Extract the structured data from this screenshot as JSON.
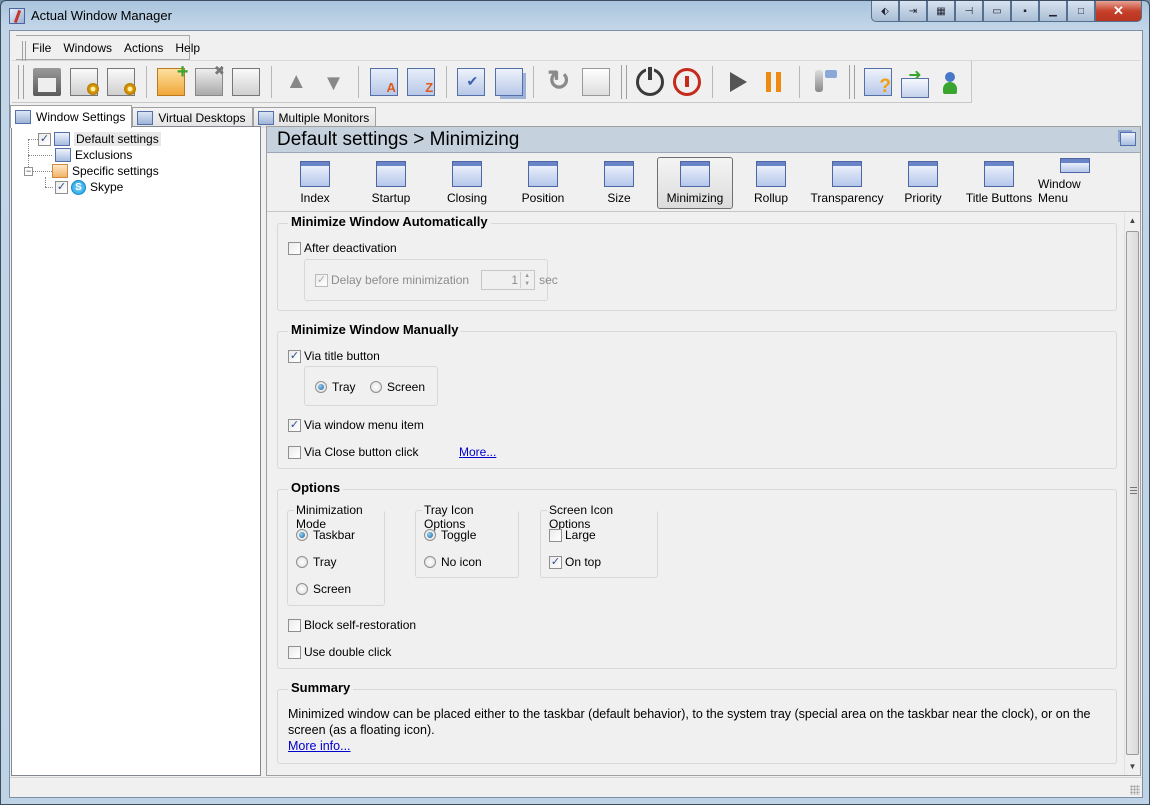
{
  "window": {
    "title": "Actual Window Manager"
  },
  "title_buttons": [
    "move-icon",
    "minimize-to-tray-icon",
    "transparency-icon",
    "stay-on-top-icon",
    "rollup-icon",
    "minimize-alt-icon",
    "minimize-icon",
    "maximize-icon",
    "close-icon"
  ],
  "menu": [
    "File",
    "Windows",
    "Actions",
    "Help"
  ],
  "toolbar": [
    {
      "name": "save",
      "icon": "floppy-icon",
      "cls": "i-floppy"
    },
    {
      "name": "settings-user",
      "icon": "settings-user-icon",
      "cls": "i-doc i-gear"
    },
    {
      "name": "settings-user-2",
      "icon": "settings-user-alt-icon",
      "cls": "i-doc i-gear"
    },
    {
      "sep": true
    },
    {
      "name": "add-rule",
      "icon": "folder-add-icon",
      "cls": "i-folder-add"
    },
    {
      "name": "delete-rule",
      "icon": "folder-delete-icon",
      "cls": "i-folder-del"
    },
    {
      "name": "copy-rule",
      "icon": "copy-icon",
      "cls": "i-doc"
    },
    {
      "sep": true
    },
    {
      "name": "move-up",
      "icon": "arrow-up-icon",
      "cls": "i-up"
    },
    {
      "name": "move-down",
      "icon": "arrow-down-icon",
      "cls": "i-down"
    },
    {
      "sep": true
    },
    {
      "name": "sort-za",
      "icon": "sort-za-icon",
      "cls": "i-za"
    },
    {
      "name": "sort-az",
      "icon": "sort-az-icon",
      "cls": "i-az"
    },
    {
      "sep": true
    },
    {
      "name": "check-all",
      "icon": "check-all-icon",
      "cls": "i-check"
    },
    {
      "name": "cascade",
      "icon": "cascade-icon",
      "cls": "i-cascade"
    },
    {
      "sep": true
    },
    {
      "name": "redo",
      "icon": "redo-icon",
      "cls": "i-redo"
    },
    {
      "name": "paste",
      "icon": "paste-icon",
      "cls": "i-paste"
    },
    {
      "grip": true
    },
    {
      "name": "power",
      "icon": "power-icon",
      "cls": "i-power"
    },
    {
      "name": "stop",
      "icon": "stop-icon",
      "cls": "i-stop"
    },
    {
      "sep": true
    },
    {
      "name": "play",
      "icon": "play-icon",
      "cls": "i-play"
    },
    {
      "name": "pause",
      "icon": "pause-icon",
      "cls": "i-pause"
    },
    {
      "sep": true
    },
    {
      "name": "tools",
      "icon": "tools-icon",
      "cls": "i-tools"
    },
    {
      "grip": true
    },
    {
      "name": "help",
      "icon": "help-icon",
      "cls": "i-help"
    },
    {
      "name": "feedback",
      "icon": "mail-icon",
      "cls": "i-mail"
    },
    {
      "name": "support",
      "icon": "support-icon",
      "cls": "i-support"
    }
  ],
  "tabs": [
    {
      "label": "Window Settings",
      "active": true
    },
    {
      "label": "Virtual Desktops",
      "active": false
    },
    {
      "label": "Multiple Monitors",
      "active": false
    }
  ],
  "tree": {
    "default_settings": {
      "label": "Default settings",
      "checked": true
    },
    "exclusions": {
      "label": "Exclusions"
    },
    "specific_settings": {
      "label": "Specific settings",
      "expander": "−"
    },
    "skype": {
      "label": "Skype",
      "checked": true
    }
  },
  "header": {
    "breadcrumb": "Default settings > Minimizing"
  },
  "categories": [
    {
      "label": "Index",
      "icon": "signpost-icon"
    },
    {
      "label": "Startup",
      "icon": "flag-icon"
    },
    {
      "label": "Closing",
      "icon": "close-window-icon"
    },
    {
      "label": "Position",
      "icon": "move-arrows-icon"
    },
    {
      "label": "Size",
      "icon": "resize-icon"
    },
    {
      "label": "Minimizing",
      "icon": "minimize-window-icon",
      "active": true
    },
    {
      "label": "Rollup",
      "icon": "rollup-icon"
    },
    {
      "label": "Transparency",
      "icon": "transparency-icon"
    },
    {
      "label": "Priority",
      "icon": "clock-icon"
    },
    {
      "label": "Title Buttons",
      "icon": "title-buttons-icon"
    },
    {
      "label": "Window Menu",
      "icon": "window-menu-icon"
    }
  ],
  "auto": {
    "title": "Minimize Window Automatically",
    "after_deactivation": {
      "label": "After deactivation",
      "checked": false
    },
    "delay": {
      "label": "Delay before minimization",
      "checked": true,
      "value": "1",
      "unit": "sec"
    }
  },
  "manual": {
    "title": "Minimize Window Manually",
    "via_title": {
      "label": "Via title button",
      "checked": true
    },
    "tray": {
      "label": "Tray",
      "selected": true
    },
    "screen": {
      "label": "Screen",
      "selected": false
    },
    "via_menu": {
      "label": "Via window menu item",
      "checked": true
    },
    "via_close": {
      "label": "Via Close button click",
      "checked": false
    },
    "more": "More..."
  },
  "options": {
    "title": "Options",
    "mode": {
      "title": "Minimization Mode",
      "items": [
        {
          "label": "Taskbar",
          "selected": true
        },
        {
          "label": "Tray",
          "selected": false
        },
        {
          "label": "Screen",
          "selected": false
        }
      ]
    },
    "tray_icon": {
      "title": "Tray Icon Options",
      "items": [
        {
          "label": "Toggle",
          "selected": true
        },
        {
          "label": "No icon",
          "selected": false
        }
      ]
    },
    "screen_icon": {
      "title": "Screen Icon Options",
      "items": [
        {
          "label": "Large",
          "checked": false
        },
        {
          "label": "On top",
          "checked": true
        }
      ]
    },
    "block": {
      "label": "Block self-restoration",
      "checked": false
    },
    "double": {
      "label": "Use double click",
      "checked": false
    }
  },
  "summary": {
    "title": "Summary",
    "text": "Minimized window can be placed either to the taskbar (default behavior), to the system tray (special area on the taskbar near the clock), or on the screen (as a floating icon).",
    "link": "More info..."
  }
}
